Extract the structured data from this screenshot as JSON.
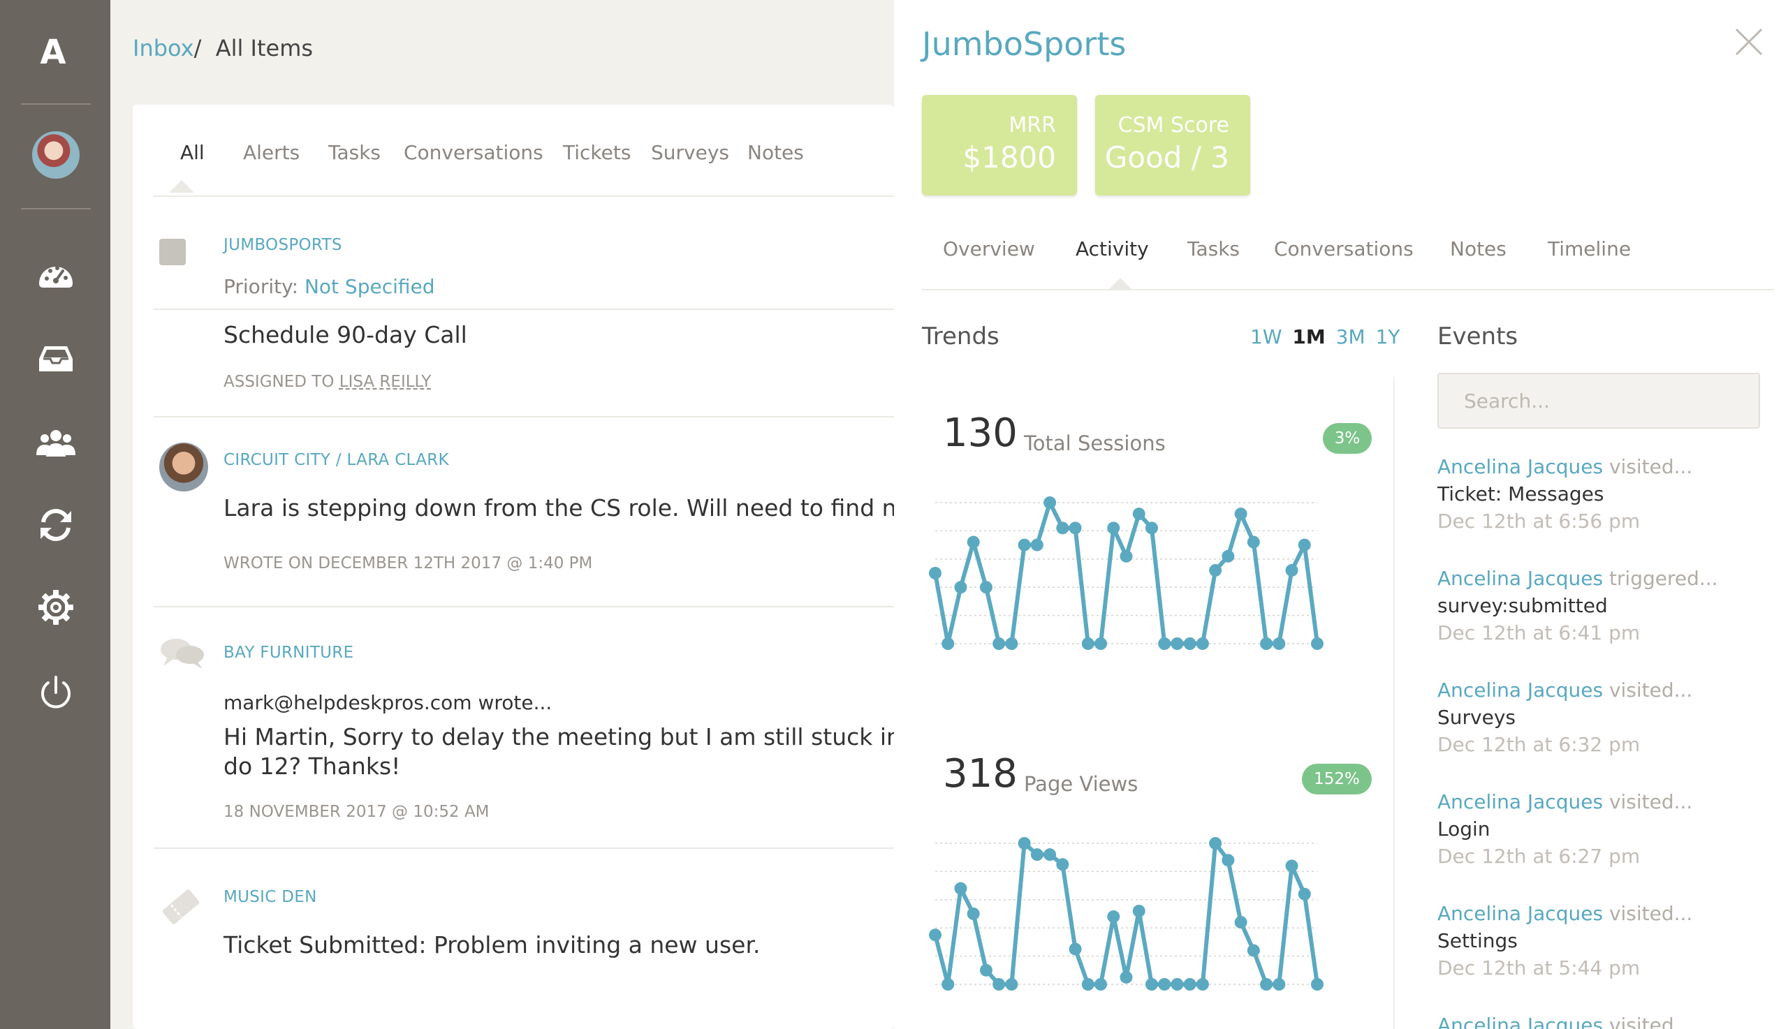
{
  "sidebar": {
    "logo": "A",
    "icons": [
      "dashboard-icon",
      "inbox-icon",
      "users-icon",
      "sync-icon",
      "settings-icon",
      "power-icon"
    ]
  },
  "breadcrumb": {
    "link": "Inbox",
    "separator": "/",
    "current": "All Items"
  },
  "main_tabs": [
    "All",
    "Alerts",
    "Tasks",
    "Conversations",
    "Tickets",
    "Surveys",
    "Notes"
  ],
  "feed": [
    {
      "org": "JUMBOSPORTS",
      "priority_label": "Priority:",
      "priority_value": "Not Specified",
      "title": "Schedule 90-day Call",
      "assigned_prefix": "ASSIGNED TO",
      "assignee": "LISA REILLY"
    },
    {
      "org": "CIRCUIT CITY / LARA CLARK",
      "body": "Lara is stepping down from the CS role. Will need to find new inte",
      "meta": "WROTE ON DECEMBER 12TH 2017 @ 1:40 PM"
    },
    {
      "org": "BAY FURNITURE",
      "author": "mark@helpdeskpros.com wrote...",
      "body_line1": "Hi Martin, Sorry to delay the meeting but I am still stuck in anothe",
      "body_line2": "do 12? Thanks!",
      "meta": "18 NOVEMBER 2017 @ 10:52 AM"
    },
    {
      "org": "MUSIC DEN",
      "body": "Ticket Submitted: Problem inviting a new user."
    }
  ],
  "panel": {
    "title": "JumboSports",
    "stats": [
      {
        "label": "MRR",
        "value": "$1800"
      },
      {
        "label": "CSM Score",
        "value": "Good / 3"
      }
    ],
    "tabs": [
      "Overview",
      "Activity",
      "Tasks",
      "Conversations",
      "Notes",
      "Timeline"
    ],
    "trends_title": "Trends",
    "ranges": [
      "1W",
      "1M",
      "3M",
      "1Y"
    ],
    "active_range": "1M",
    "events_title": "Events",
    "search_placeholder": "Search...",
    "events": [
      {
        "who": "Ancelina Jacques",
        "action": "visited...",
        "what": "Ticket: Messages",
        "when": "Dec 12th at 6:56 pm"
      },
      {
        "who": "Ancelina Jacques",
        "action": "triggered...",
        "what": "survey:submitted",
        "when": "Dec 12th at 6:41 pm"
      },
      {
        "who": "Ancelina Jacques",
        "action": "visited...",
        "what": "Surveys",
        "when": "Dec 12th at 6:32 pm"
      },
      {
        "who": "Ancelina Jacques",
        "action": "visited...",
        "what": "Login",
        "when": "Dec 12th at 6:27 pm"
      },
      {
        "who": "Ancelina Jacques",
        "action": "visited...",
        "what": "Settings",
        "when": "Dec 12th at 5:44 pm"
      },
      {
        "who": "Ancelina Jacques",
        "action": "visited...",
        "what": "",
        "when": ""
      }
    ]
  },
  "chart_data": [
    {
      "type": "line",
      "value": "130",
      "label": "Total Sessions",
      "change": "3%",
      "color": "#5ba9c1",
      "values": [
        50,
        0,
        40,
        72,
        40,
        0,
        0,
        70,
        70,
        100,
        82,
        82,
        0,
        0,
        82,
        62,
        92,
        82,
        0,
        0,
        0,
        0,
        52,
        62,
        92,
        72,
        0,
        0,
        52,
        70,
        0
      ],
      "ylim": [
        0,
        100
      ]
    },
    {
      "type": "line",
      "value": "318",
      "label": "Page Views",
      "change": "152%",
      "color": "#5ba9c1",
      "values": [
        35,
        0,
        68,
        50,
        10,
        0,
        0,
        100,
        92,
        92,
        85,
        25,
        0,
        0,
        48,
        5,
        52,
        0,
        0,
        0,
        0,
        0,
        100,
        88,
        44,
        24,
        0,
        0,
        84,
        64,
        0
      ],
      "ylim": [
        0,
        100
      ]
    }
  ]
}
